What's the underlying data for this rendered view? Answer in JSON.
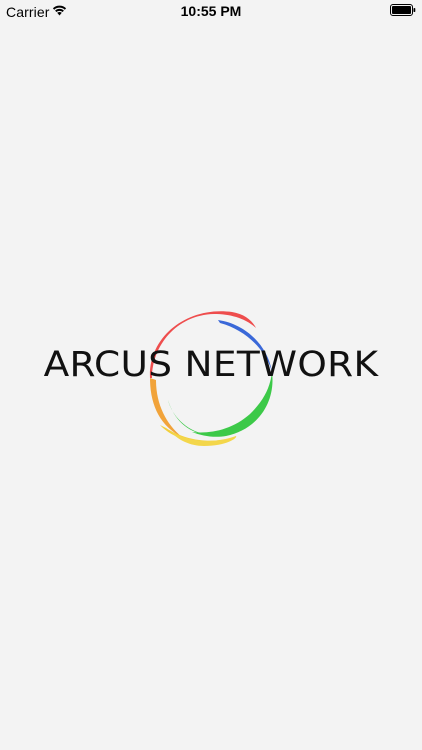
{
  "status_bar": {
    "carrier": "Carrier",
    "time": "10:55 PM",
    "wifi_icon": "wifi-icon",
    "battery_icon": "battery-icon"
  },
  "splash": {
    "logo_text": "ARCUS NETWORK",
    "ring_colors": [
      "#ef4b4b",
      "#3f6fd9",
      "#3ecb47",
      "#f2c23a"
    ]
  },
  "background_color": "#f3f3f3"
}
